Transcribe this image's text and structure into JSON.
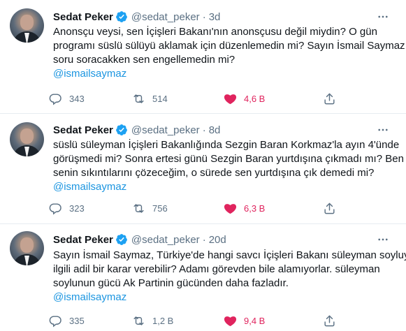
{
  "colors": {
    "link": "#1b95e0",
    "like": "#e0245e",
    "muted": "#5b7083",
    "verified": "#1da1f2"
  },
  "tweets": [
    {
      "name": "Sedat Peker",
      "handle": "@sedat_peker",
      "separator": "·",
      "time": "3d",
      "lines": [
        "Anonsçu veysi, sen İçişleri Bakanı'nın anonsçusu değil miydin? O gün",
        "programı süslü sülüyü aklamak için düzenlemedin mi? Sayın İsmail Saymaz",
        "soru soracakken sen engellemedin mi?"
      ],
      "mention": "@ismailsaymaz",
      "replies": "343",
      "retweets": "514",
      "likes": "4,6 B"
    },
    {
      "name": "Sedat Peker",
      "handle": "@sedat_peker",
      "separator": "·",
      "time": "8d",
      "lines": [
        "süslü süleyman İçişleri Bakanlığında Sezgin Baran Korkmaz'la ayın 4'ünde",
        "görüşmedi mi? Sonra ertesi günü Sezgin Baran yurtdışına çıkmadı mı? Ben",
        "senin sıkıntılarını çözeceğim,  o sürede sen yurtdışına çık demedi mi?"
      ],
      "mention": "@ismailsaymaz",
      "replies": "323",
      "retweets": "756",
      "likes": "6,3 B"
    },
    {
      "name": "Sedat Peker",
      "handle": "@sedat_peker",
      "separator": "·",
      "time": "20d",
      "lines": [
        "Sayın İsmail Saymaz, Türkiye'de hangi savcı İçişleri Bakanı süleyman soyluyla",
        "ilgili adil bir karar verebilir? Adamı görevden bile alamıyorlar. süleyman",
        "soylunun gücü Ak Partinin gücünden daha fazladır."
      ],
      "mention": "@ismailsaymaz",
      "replies": "335",
      "retweets": "1,2 B",
      "likes": "9,4 B"
    }
  ],
  "icons": {
    "verified": "verified-badge-icon",
    "more": "more-options-icon",
    "reply": "reply-icon",
    "retweet": "retweet-icon",
    "like": "heart-icon",
    "share": "share-icon"
  }
}
